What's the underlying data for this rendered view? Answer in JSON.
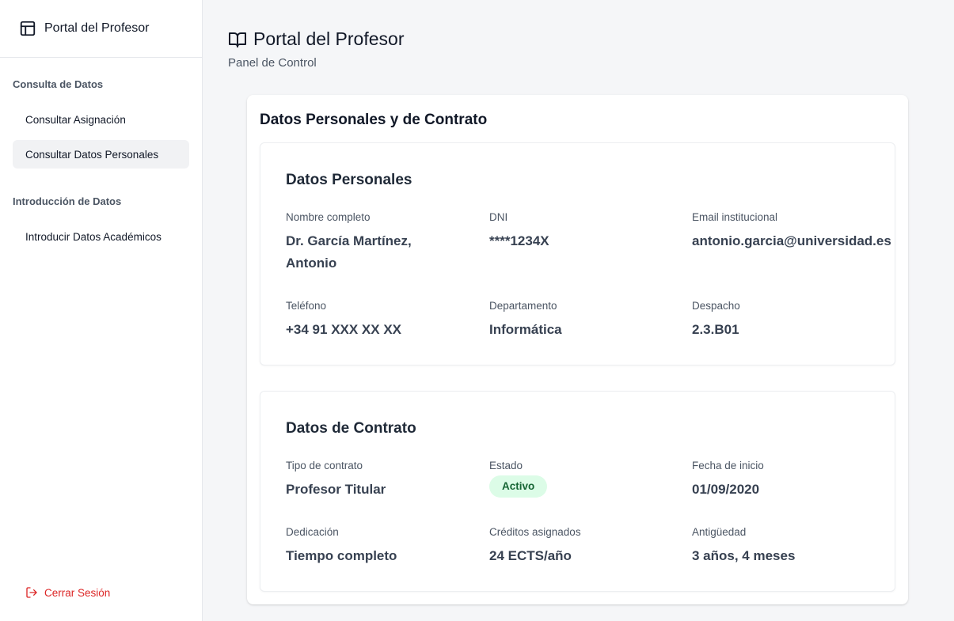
{
  "sidebar": {
    "brand_title": "Portal del Profesor",
    "brand_icon": "layout-icon",
    "sections": [
      {
        "label": "Consulta de Datos",
        "items": [
          {
            "label": "Consultar Asignación",
            "active": false
          },
          {
            "label": "Consultar Datos Personales",
            "active": true
          }
        ]
      },
      {
        "label": "Introducción de Datos",
        "items": [
          {
            "label": "Introducir Datos Académicos",
            "active": false
          }
        ]
      }
    ],
    "logout_label": "Cerrar Sesión",
    "logout_icon": "logout-icon"
  },
  "header": {
    "title": "Portal del Profesor",
    "subtitle": "Panel de Control",
    "icon": "book-open-icon"
  },
  "card": {
    "title": "Datos Personales y de Contrato",
    "personal": {
      "title": "Datos Personales",
      "fields": [
        {
          "label": "Nombre completo",
          "value": "Dr. García Martínez, Antonio"
        },
        {
          "label": "DNI",
          "value": "****1234X"
        },
        {
          "label": "Email institucional",
          "value": "antonio.garcia@universidad.es"
        },
        {
          "label": "Teléfono",
          "value": "+34 91 XXX XX XX"
        },
        {
          "label": "Departamento",
          "value": "Informática"
        },
        {
          "label": "Despacho",
          "value": "2.3.B01"
        }
      ]
    },
    "contract": {
      "title": "Datos de Contrato",
      "fields": [
        {
          "label": "Tipo de contrato",
          "value": "Profesor Titular"
        },
        {
          "label": "Estado",
          "value": "Activo"
        },
        {
          "label": "Fecha de inicio",
          "value": "01/09/2020"
        },
        {
          "label": "Dedicación",
          "value": "Tiempo completo"
        },
        {
          "label": "Créditos asignados",
          "value": "24 ECTS/año"
        },
        {
          "label": "Antigüedad",
          "value": "3 años, 4 meses"
        }
      ]
    }
  },
  "colors": {
    "accent_danger": "#dc2626",
    "status_active_bg": "#dcfce7",
    "status_active_text": "#166534"
  }
}
